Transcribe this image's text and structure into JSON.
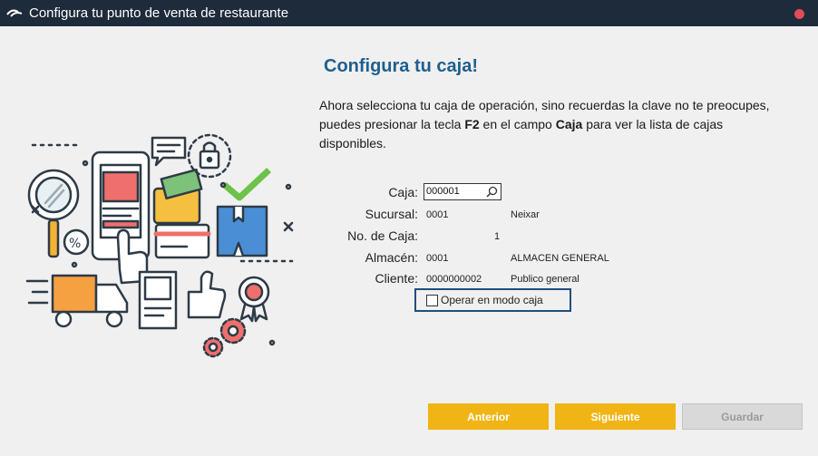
{
  "window": {
    "title": "Configura tu punto de venta de restaurante"
  },
  "page": {
    "heading": "Configura tu caja!",
    "description": {
      "part1": "Ahora selecciona tu caja de operación, sino recuerdas la clave no te preocupes, puedes presionar la tecla ",
      "key": "F2",
      "part2": " en el campo ",
      "field": "Caja",
      "part3": " para ver la lista de cajas disponibles."
    }
  },
  "form": {
    "caja": {
      "label": "Caja:",
      "value": "000001"
    },
    "sucursal": {
      "label": "Sucursal:",
      "code": "0001",
      "name": "Neixar"
    },
    "no_caja": {
      "label": "No. de Caja:",
      "value": "1"
    },
    "almacen": {
      "label": "Almacén:",
      "code": "0001",
      "name": "ALMACEN GENERAL"
    },
    "cliente": {
      "label": "Cliente:",
      "code": "0000000002",
      "name": "Publico general"
    },
    "modo_caja": {
      "label": "Operar en modo caja",
      "checked": false
    }
  },
  "buttons": {
    "anterior": "Anterior",
    "siguiente": "Siguiente",
    "guardar": "Guardar"
  },
  "colors": {
    "titlebar": "#1d2b3a",
    "heading": "#1f5f8e",
    "accent_button": "#f0b414",
    "disabled_button": "#d9d9d9",
    "focus_border": "#1f4f7e",
    "close": "#e24b57"
  },
  "icons": {
    "app": "app-logo-icon",
    "close": "close-icon",
    "search": "search-icon"
  }
}
